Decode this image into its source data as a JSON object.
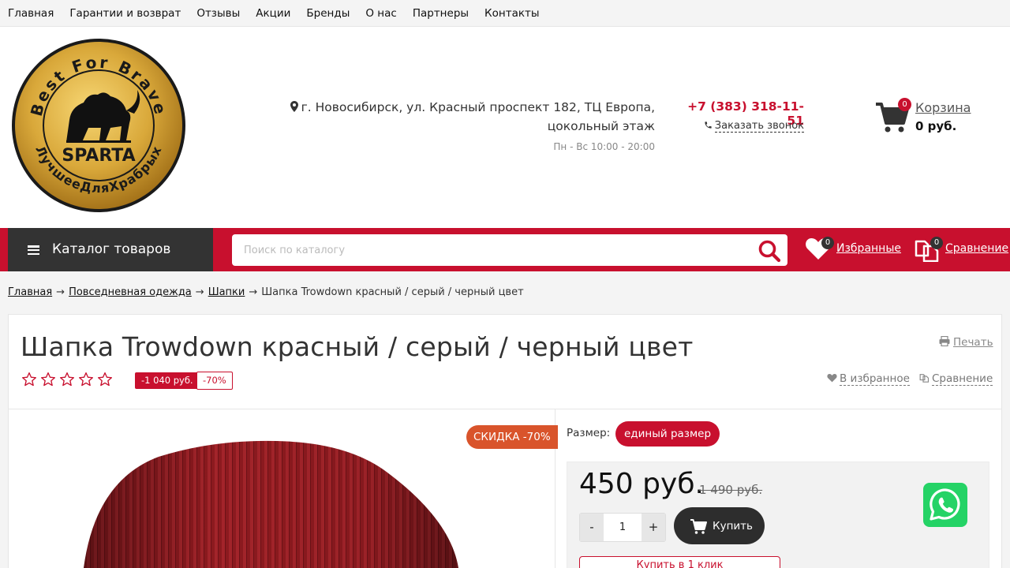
{
  "topnav": {
    "items": [
      "Главная",
      "Гарантии и возврат",
      "Отзывы",
      "Акции",
      "Бренды",
      "О нас",
      "Партнеры",
      "Контакты"
    ]
  },
  "header": {
    "logo_text": {
      "ring_top": "Best For Brave",
      "ring_bottom": "ЛучшееДляХрабрых",
      "center": "SPARTA"
    },
    "address": "г. Новосибирск, ул. Красный проспект 182, ТЦ Европа, цокольный этаж",
    "hours": "Пн - Вс 10:00 - 20:00",
    "phone": "+7 (383) 318-11-51",
    "callback": "Заказать звонок",
    "cart": {
      "label": "Корзина",
      "sum": "0 руб.",
      "count": "0"
    }
  },
  "bar": {
    "catalog": "Каталог товаров",
    "search_placeholder": "Поиск по каталогу",
    "favorites": {
      "label": "Избранные",
      "count": "0"
    },
    "compare": {
      "label": "Сравнение",
      "count": "0"
    }
  },
  "breadcrumbs": {
    "items": [
      "Главная",
      "Повседневная одежда",
      "Шапки"
    ],
    "current": "Шапка Trowdown красный / серый / черный цвет",
    "sep": "→"
  },
  "product": {
    "title": "Шапка Trowdown красный / серый / черный цвет",
    "print": "Печать",
    "rating": 0,
    "rating_max": 5,
    "discount_amount": "-1 040 руб.",
    "discount_percent": "-70%",
    "to_favorites": "В избранное",
    "to_compare": "Сравнение",
    "sale_badge": "СКИДКА -70%",
    "size_label": "Размер:",
    "size_value": "единый размер",
    "price": "450 руб.",
    "old_price": "1 490 руб.",
    "qty_minus": "-",
    "qty_value": "1",
    "qty_plus": "+",
    "buy": "Купить",
    "one_click": "Купить в 1 клик"
  },
  "colors": {
    "accent": "#c8102e",
    "dark": "#333333",
    "sale": "#d9542b",
    "whatsapp": "#25d366"
  },
  "icons": [
    "map-pin-icon",
    "phone-icon",
    "cart-icon",
    "menu-icon",
    "search-icon",
    "heart-icon",
    "compare-icon",
    "print-icon",
    "star-icon",
    "whatsapp-icon"
  ]
}
